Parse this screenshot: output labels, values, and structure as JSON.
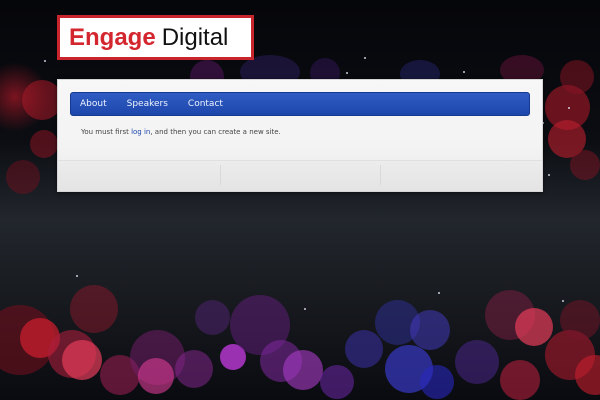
{
  "logo": {
    "word1": "Engage",
    "word2": "Digital"
  },
  "nav": {
    "items": [
      {
        "label": "About"
      },
      {
        "label": "Speakers"
      },
      {
        "label": "Contact"
      }
    ]
  },
  "message": {
    "before": "You must first ",
    "link": "log in",
    "after": ", and then you can create a new site."
  },
  "colors": {
    "brand_red": "#d4262e",
    "nav_blue": "#1e47ab",
    "panel_bg": "#f3f3f3",
    "background": "#0b0d12"
  }
}
